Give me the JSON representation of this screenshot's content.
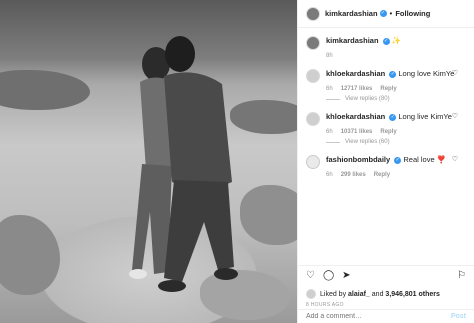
{
  "header": {
    "username": "kimkardashian",
    "follow_state": "Following",
    "separator": "•"
  },
  "caption": {
    "username": "kimkardashian",
    "text": "✨",
    "time": "8h"
  },
  "comments": [
    {
      "username": "khloekardashian",
      "text": "Long love KimYe",
      "time": "6h",
      "likes": "12717 likes",
      "reply": "Reply",
      "view_replies": "View replies (80)"
    },
    {
      "username": "khloekardashian",
      "text": "Long live KimYe",
      "time": "6h",
      "likes": "10371 likes",
      "reply": "Reply",
      "view_replies": "View replies (60)"
    },
    {
      "username": "fashionbombdaily",
      "text": "Real love ❣️",
      "time": "6h",
      "likes": "299 likes",
      "reply": "Reply"
    }
  ],
  "liked_by": {
    "prefix": "Liked by",
    "user": "alaiaf_",
    "and": "and",
    "others": "3,946,801 others"
  },
  "timestamp": "8 HOURS AGO",
  "add_comment": {
    "placeholder": "Add a comment…",
    "post_label": "Post"
  },
  "icons": {
    "verified": "verified-badge-icon",
    "heart": "heart-icon",
    "comment": "comment-icon",
    "share": "share-icon",
    "bookmark": "bookmark-icon"
  }
}
